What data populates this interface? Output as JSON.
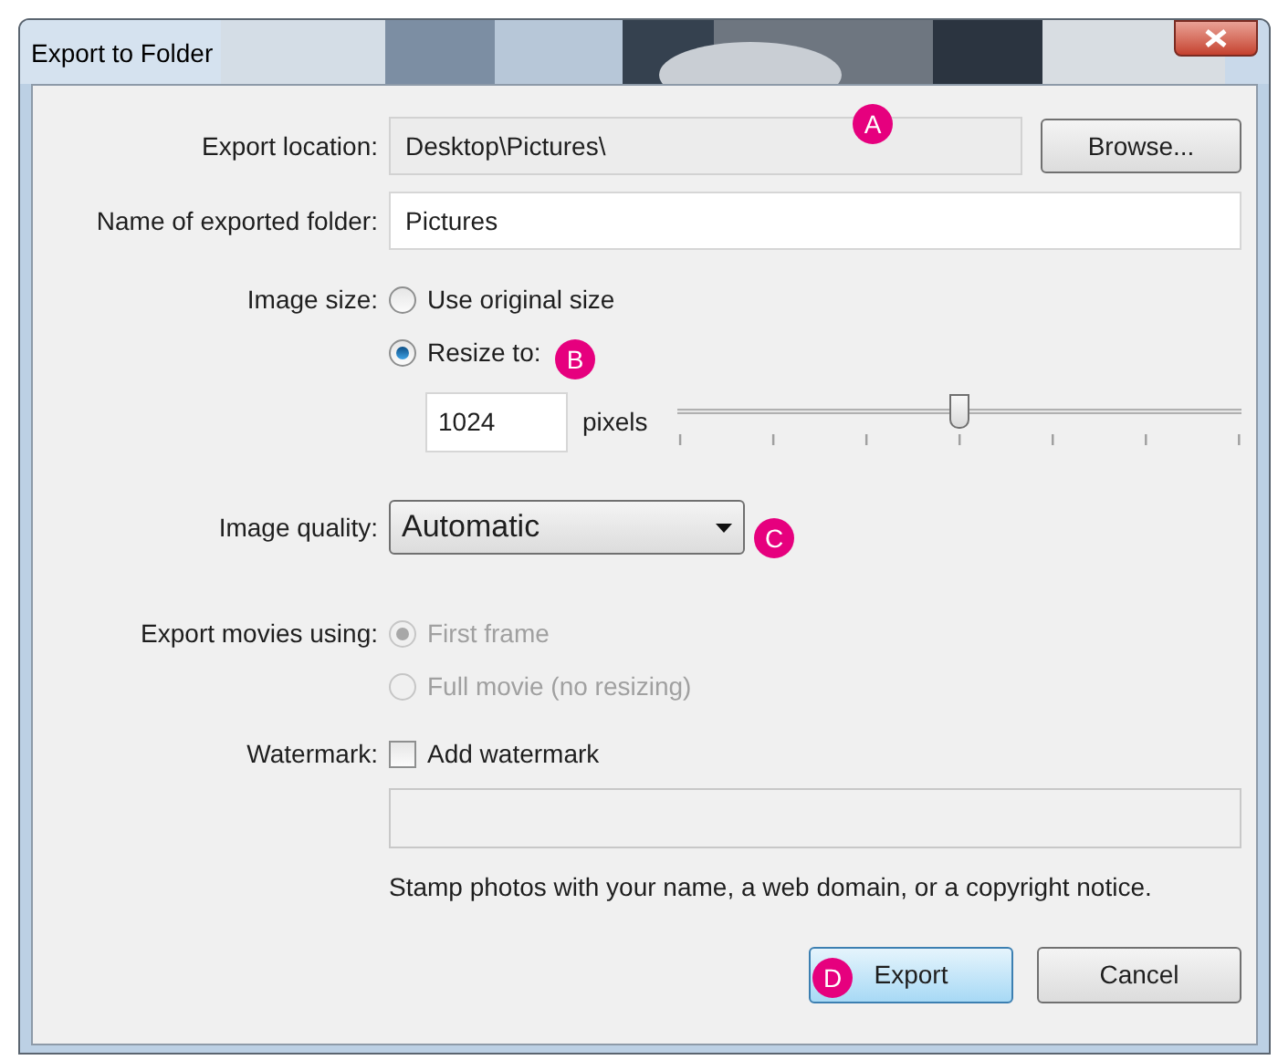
{
  "window": {
    "title": "Export to Folder"
  },
  "export_location": {
    "label": "Export location:",
    "value": "Desktop\\Pictures\\",
    "button": "Browse..."
  },
  "folder_name": {
    "label": "Name of exported folder:",
    "value": "Pictures"
  },
  "image_size": {
    "label": "Image size:",
    "options": [
      {
        "label": "Use original size",
        "selected": false
      },
      {
        "label": "Resize to:",
        "selected": true
      }
    ],
    "pixels_value": "1024",
    "pixels_unit": "pixels",
    "level": 0.5
  },
  "image_quality": {
    "label": "Image quality:",
    "value": "Automatic"
  },
  "export_movies": {
    "label": "Export movies using:",
    "disabled": true,
    "options": [
      {
        "label": "First frame",
        "selected": true
      },
      {
        "label": "Full movie (no resizing)",
        "selected": false
      }
    ]
  },
  "watermark": {
    "label": "Watermark:",
    "checkbox": "Add watermark",
    "checked": false,
    "hint": "Stamp photos with your name, a web domain, or a copyright notice."
  },
  "buttons": [
    {
      "label": "Export",
      "default": true
    },
    {
      "label": "Cancel",
      "default": false
    }
  ],
  "callouts": [
    {
      "letter": "A"
    },
    {
      "letter": "B"
    },
    {
      "letter": "C"
    },
    {
      "letter": "D"
    }
  ]
}
